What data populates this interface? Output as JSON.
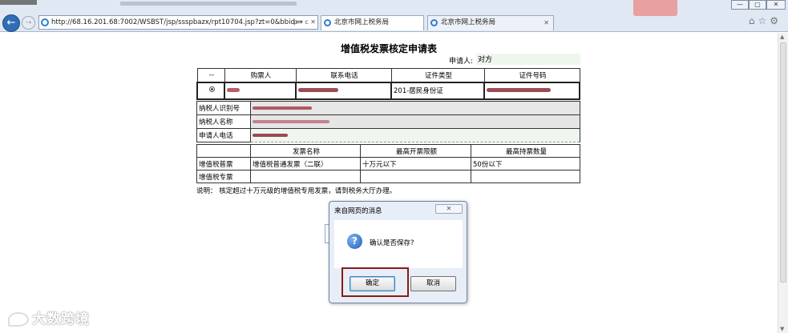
{
  "browser": {
    "address": "http://68.16.201.68:7002/WSBST/jsp/ssspbazx/rpt10704.jsp?zt=0&bbid=",
    "address_tools": "ρ ▾ c ✕",
    "tabs": [
      {
        "label": "北京市网上税务局",
        "active": true
      },
      {
        "label": "北京市网上税务局",
        "active": false
      }
    ],
    "window_controls": [
      "—",
      "▢",
      "✕"
    ],
    "right_icons": "⌂☆⚙"
  },
  "page": {
    "title": "增值税发票核定申请表",
    "applicant_label": "申请人:",
    "applicant_value": "对方",
    "purchaser_table": {
      "headers": [
        "--",
        "购票人",
        "联系电话",
        "证件类型",
        "证件号码"
      ],
      "row": {
        "id_type": "201-居民身份证"
      }
    },
    "taxpayer_rows": [
      {
        "label": "纳税人识别号"
      },
      {
        "label": "纳税人名称"
      },
      {
        "label": "申请人电话"
      }
    ],
    "invoice_table": {
      "headers": [
        "",
        "发票名称",
        "最高开票限额",
        "最高持票数量"
      ],
      "rows": [
        {
          "type": "增值税普票",
          "name": "增值税普通发票（二联）",
          "limit": "十万元以下",
          "qty": "50份以下"
        },
        {
          "type": "增值税专票",
          "name": "",
          "limit": "",
          "qty": ""
        }
      ]
    },
    "note": "说明：   核定超过十万元级的增值税专用发票，请到税务大厅办理。"
  },
  "dialog": {
    "title": "来自网页的消息",
    "message": "确认是否保存?",
    "ok_label": "确定",
    "cancel_label": "取消",
    "close_label": "✕"
  },
  "watermark": "大数跨境"
}
